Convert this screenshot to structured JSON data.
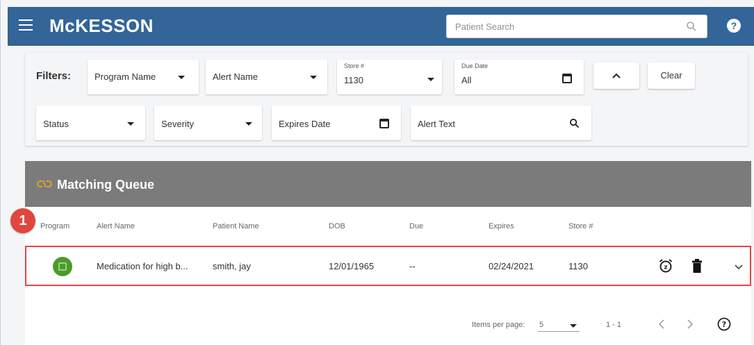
{
  "header": {
    "logo": "McKESSON",
    "search_placeholder": "Patient Search",
    "help_label": "?"
  },
  "filters": {
    "label": "Filters:",
    "program_name": "Program Name",
    "alert_name": "Alert Name",
    "store_label": "Store #",
    "store_value": "1130",
    "due_date_label": "Due Date",
    "due_date_value": "All",
    "clear_label": "Clear",
    "status": "Status",
    "severity": "Severity",
    "expires_date": "Expires Date",
    "alert_text": "Alert Text"
  },
  "queue": {
    "title": "Matching Queue",
    "columns": [
      "Program",
      "Alert Name",
      "Patient Name",
      "DOB",
      "Due",
      "Expires",
      "Store #"
    ],
    "rows": [
      {
        "alert_name": "Medication for high b...",
        "patient_name": "smith, jay",
        "dob": "12/01/1965",
        "due": "--",
        "expires": "02/24/2021",
        "store": "1130"
      }
    ]
  },
  "callout": "1",
  "pagination": {
    "items_per_page_label": "Items per page:",
    "items_per_page_value": "5",
    "range": "1 - 1"
  },
  "colors": {
    "header": "#336598",
    "queue_header": "#7b7b7b",
    "highlight": "#e04848",
    "accent_link": "#e0a030",
    "program_green": "#4c9a2a"
  }
}
